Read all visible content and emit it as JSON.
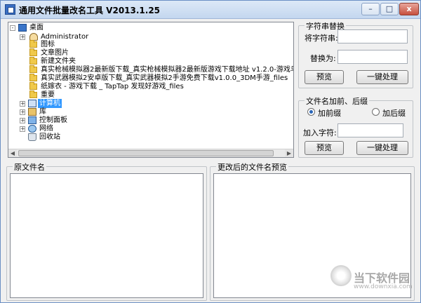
{
  "window": {
    "title": "通用文件批量改名工具  V2013.1.25",
    "minimize_glyph": "–",
    "maximize_glyph": "□",
    "close_glyph": "x"
  },
  "tree": {
    "items": [
      {
        "label": "桌面",
        "icon": "desktop-icon"
      },
      {
        "label": "Administrator",
        "icon": "user-icon"
      },
      {
        "label": "图标",
        "icon": "folder-icon"
      },
      {
        "label": "文章图片",
        "icon": "folder-icon"
      },
      {
        "label": "新建文件夹",
        "icon": "folder-icon"
      },
      {
        "label": "真实枪械模拟器2最新版下载_真实枪械模拟器2最新版游戏下载地址 v1.2.0-游戏鸟手游网_fi",
        "icon": "folder-icon"
      },
      {
        "label": "真实武器模拟2安卓版下载_真实武器模拟2手游免费下载v1.0.0_3DM手游_files",
        "icon": "folder-icon"
      },
      {
        "label": "纸嫁衣 - 游戏下载 _ TapTap 发现好游戏_files",
        "icon": "folder-icon"
      },
      {
        "label": "重要",
        "icon": "folder-icon"
      },
      {
        "label": "计算机",
        "icon": "computer-icon"
      },
      {
        "label": "库",
        "icon": "library-icon"
      },
      {
        "label": "控制面板",
        "icon": "control-panel-icon"
      },
      {
        "label": "网络",
        "icon": "network-icon"
      },
      {
        "label": "回收站",
        "icon": "recycle-bin-icon"
      }
    ],
    "expander_glyph": "+",
    "collapse_glyph": "-",
    "scroll_left_glyph": "◀",
    "scroll_right_glyph": "▶"
  },
  "replace_group": {
    "title": "字符串替换",
    "find_label": "将字符串:",
    "find_value": "",
    "replace_label": "替换为:",
    "replace_value": "",
    "preview_button": "预览",
    "apply_button": "一键处理"
  },
  "affix_group": {
    "title": "文件名加前、后缀",
    "prefix_label": "加前缀",
    "suffix_label": "加后缀",
    "selected": "prefix",
    "add_chars_label": "加入字符:",
    "add_chars_value": "",
    "preview_button": "预览",
    "apply_button": "一键处理"
  },
  "original_group": {
    "title": "原文件名"
  },
  "preview_group": {
    "title": "更改后的文件名预览"
  },
  "watermark": {
    "brand": "当下软件园",
    "url": "www.downxia.com"
  }
}
